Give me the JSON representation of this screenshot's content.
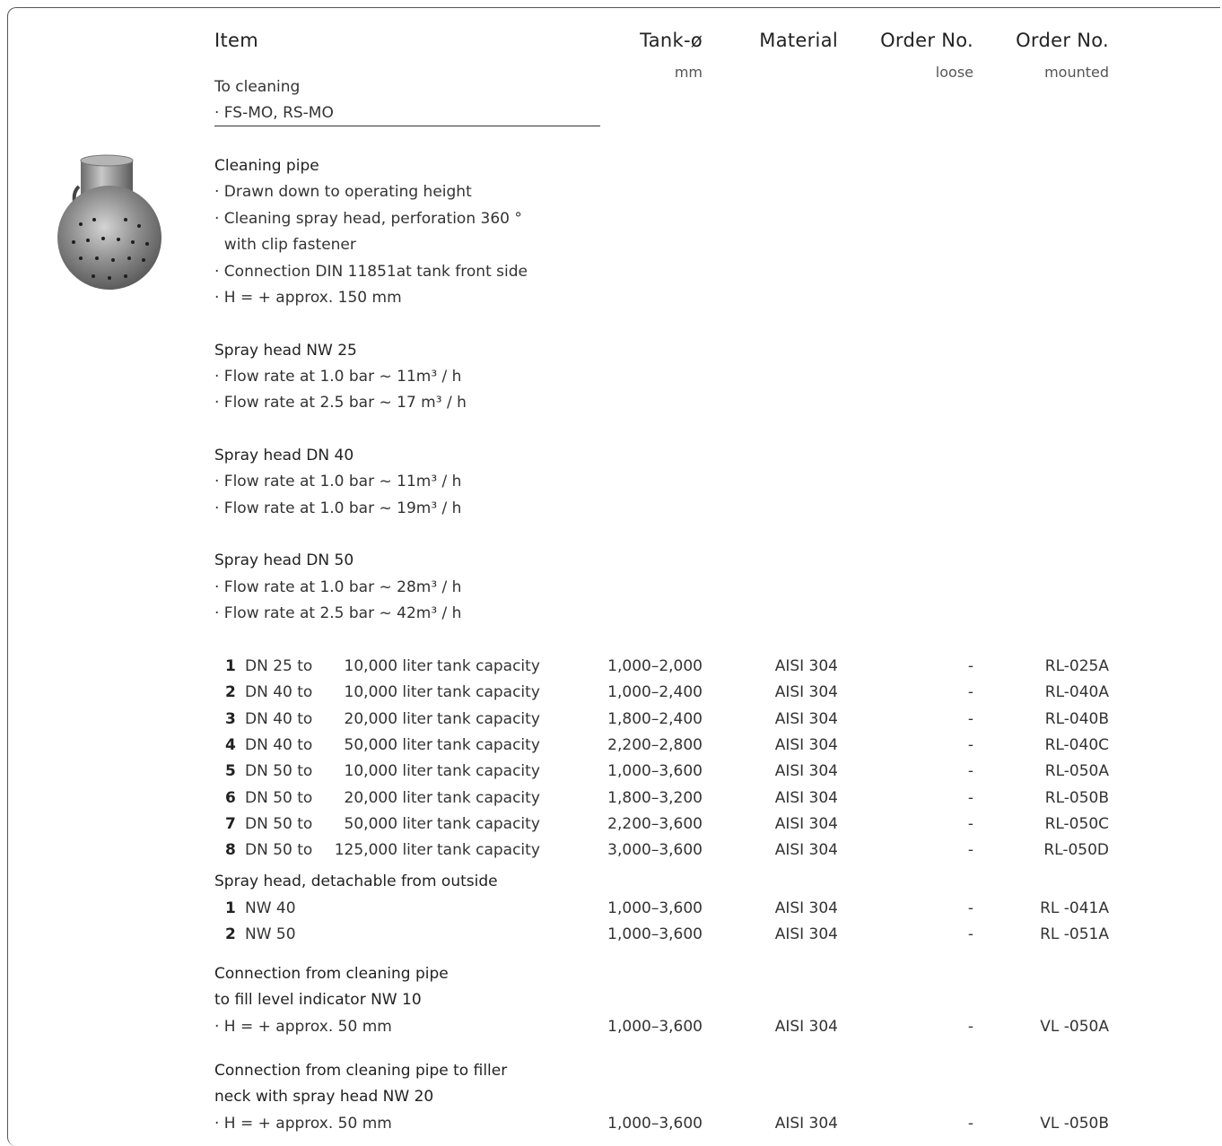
{
  "header": {
    "item": "Item",
    "tank": "Tank-ø",
    "material": "Material",
    "order_loose": "Order No.",
    "order_mounted": "Order No.",
    "tank_unit": "mm",
    "loose_sub": "loose",
    "mounted_sub": "mounted"
  },
  "intro": {
    "line1": "To cleaning",
    "line2": "· FS-MO, RS-MO"
  },
  "cleaning_pipe": {
    "title": "Cleaning pipe",
    "lines": [
      "· Drawn down to operating height",
      "· Cleaning spray head, perforation 360 °",
      "  with clip fastener",
      "· Connection DIN 11851at tank front side",
      "· H = + approx. 150 mm"
    ]
  },
  "spray_nw25": {
    "title": "Spray head NW 25",
    "lines": [
      "· Flow rate at 1.0 bar ~ 11m³ / h",
      "· Flow rate at 2.5 bar ~ 17 m³ / h"
    ]
  },
  "spray_dn40": {
    "title": "Spray head DN 40",
    "lines": [
      "· Flow rate at 1.0 bar ~ 11m³ / h",
      "· Flow rate at 1.0 bar ~ 19m³ / h"
    ]
  },
  "spray_dn50": {
    "title": "Spray head DN 50",
    "lines": [
      "· Flow rate at 1.0 bar ~ 28m³ / h",
      "· Flow rate at 2.5 bar ~ 42m³ / h"
    ]
  },
  "rows": [
    {
      "n": "1",
      "dn": "DN 25 to",
      "cap": "10,000 liter",
      "tc": "tank capacity",
      "tank": "1,000–2,000",
      "mat": "AISI 304",
      "loose": "-",
      "mounted": "RL-025A"
    },
    {
      "n": "2",
      "dn": "DN 40 to",
      "cap": "10,000 liter",
      "tc": "tank capacity",
      "tank": "1,000–2,400",
      "mat": "AISI 304",
      "loose": "-",
      "mounted": "RL-040A"
    },
    {
      "n": "3",
      "dn": "DN 40 to",
      "cap": "20,000 liter",
      "tc": "tank capacity",
      "tank": "1,800–2,400",
      "mat": "AISI 304",
      "loose": "-",
      "mounted": "RL-040B"
    },
    {
      "n": "4",
      "dn": "DN 40 to",
      "cap": "50,000 liter",
      "tc": "tank capacity",
      "tank": "2,200–2,800",
      "mat": "AISI 304",
      "loose": "-",
      "mounted": "RL-040C"
    },
    {
      "n": "5",
      "dn": "DN 50 to",
      "cap": "10,000 liter",
      "tc": "tank capacity",
      "tank": "1,000–3,600",
      "mat": "AISI 304",
      "loose": "-",
      "mounted": "RL-050A"
    },
    {
      "n": "6",
      "dn": "DN 50 to",
      "cap": "20,000 liter",
      "tc": "tank capacity",
      "tank": "1,800–3,200",
      "mat": "AISI 304",
      "loose": "-",
      "mounted": "RL-050B"
    },
    {
      "n": "7",
      "dn": "DN 50 to",
      "cap": "50,000 liter",
      "tc": "tank capacity",
      "tank": "2,200–3,600",
      "mat": "AISI 304",
      "loose": "-",
      "mounted": "RL-050C"
    },
    {
      "n": "8",
      "dn": "DN 50 to",
      "cap": "125,000 liter",
      "tc": "tank capacity",
      "tank": "3,000–3,600",
      "mat": "AISI 304",
      "loose": "-",
      "mounted": "RL-050D"
    }
  ],
  "detachable": {
    "title": "Spray head, detachable from outside",
    "rows": [
      {
        "n": "1",
        "dn": "NW 40",
        "tank": "1,000–3,600",
        "mat": "AISI 304",
        "loose": "-",
        "mounted": "RL -041A"
      },
      {
        "n": "2",
        "dn": "NW 50",
        "tank": "1,000–3,600",
        "mat": "AISI 304",
        "loose": "-",
        "mounted": "RL -051A"
      }
    ]
  },
  "conn_fill": {
    "line1": "Connection from cleaning pipe",
    "line2": "to fill level indicator NW 10",
    "detail": "· H = + approx. 50 mm",
    "tank": "1,000–3,600",
    "mat": "AISI 304",
    "loose": "-",
    "mounted": "VL -050A"
  },
  "conn_filler": {
    "line1": "Connection from cleaning pipe to filler",
    "line2": "neck with spray head NW 20",
    "detail": "· H = + approx. 50 mm",
    "tank": "1,000–3,600",
    "mat": "AISI 304",
    "loose": "-",
    "mounted": "VL -050B"
  },
  "colors": {
    "text": "#222222",
    "muted": "#555555",
    "rule": "#333333"
  },
  "icons": {
    "product": "spray-head-photo"
  }
}
